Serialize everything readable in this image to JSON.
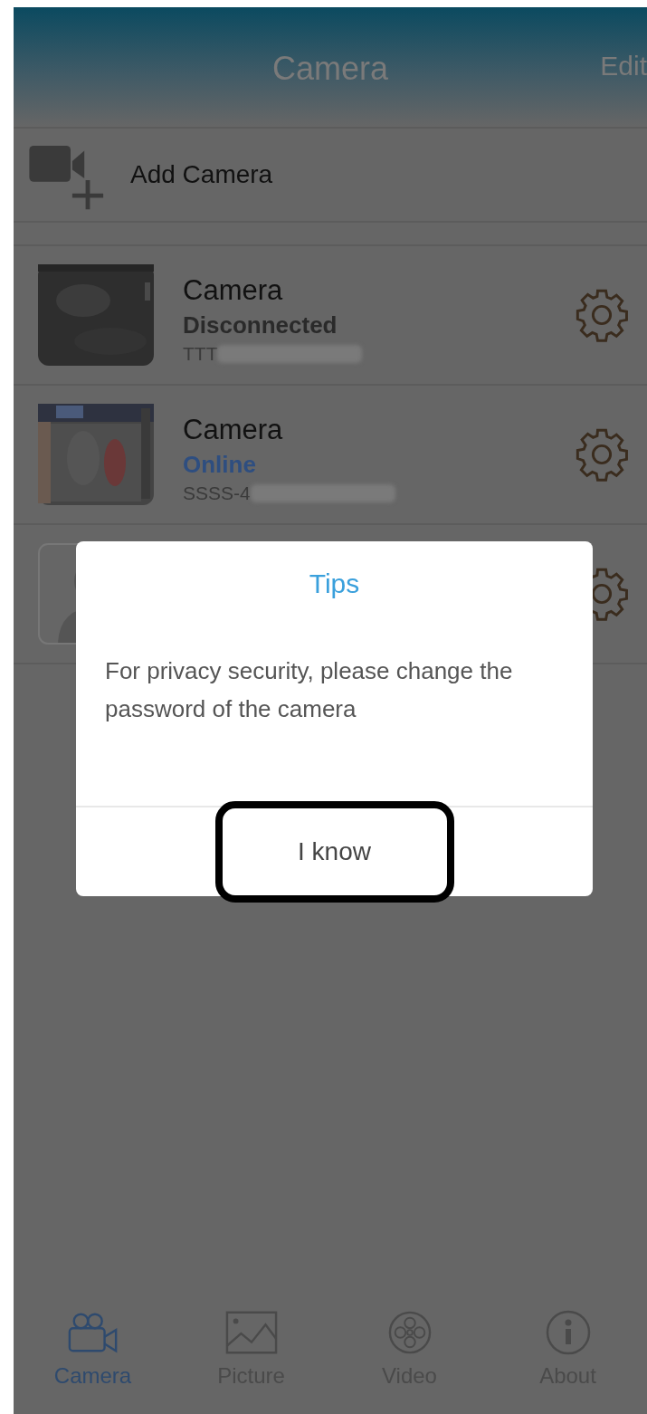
{
  "header": {
    "title": "Camera",
    "edit": "Edit"
  },
  "add_camera": {
    "label": "Add Camera"
  },
  "cameras": [
    {
      "kind": "device",
      "name": "Camera",
      "status": "Disconnected",
      "color": "#2a2a2a",
      "serial": "TTT"
    },
    {
      "kind": "device",
      "name": "Camera",
      "status": "Online",
      "color": "#2e4e80",
      "serial": "SSSS-4"
    },
    {
      "kind": "placeholder"
    }
  ],
  "dialog": {
    "title": "Tips",
    "message": "For privacy security, please change the password of the camera",
    "button": "I know",
    "highlighted": true
  },
  "tabs": [
    {
      "label": "Camera",
      "selected": true
    },
    {
      "label": "Picture",
      "selected": false
    },
    {
      "label": "Video",
      "selected": false
    },
    {
      "label": "About",
      "selected": false
    }
  ]
}
